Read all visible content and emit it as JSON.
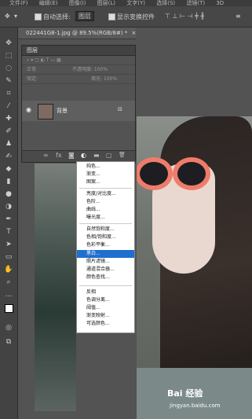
{
  "menubar": {
    "items": [
      "文件(F)",
      "编辑(E)",
      "图像(I)",
      "图层(L)",
      "文字(Y)",
      "选择(S)",
      "滤镜(T)",
      "3D"
    ]
  },
  "options": {
    "auto_select_label": "自动选择:",
    "auto_select_value": "图层",
    "show_transform_label": "显示变换控件"
  },
  "document": {
    "tab_title": "022441G8-1.jpg @ 89.5%(RGB/8#) *",
    "close": "×"
  },
  "layers_panel": {
    "title": "图层",
    "blend_mode": "正常",
    "opacity": "不透明度: 100%",
    "lock_label": "锁定:",
    "fill": "填充: 100%",
    "layer_name": "背景",
    "footer_icons": [
      "link-icon",
      "fx-icon",
      "mask-icon",
      "adjustment-icon",
      "folder-icon",
      "new-layer-icon",
      "trash-icon"
    ],
    "footer_glyphs": [
      "∞",
      "fx",
      "◙",
      "◐",
      "▬",
      "▢",
      "🗑"
    ]
  },
  "adjust_menu": {
    "items": [
      "纯色...",
      "渐变...",
      "图案...",
      "亮度/对比度...",
      "色阶...",
      "曲线...",
      "曝光度...",
      "自然饱和度...",
      "色相/饱和度...",
      "色彩平衡...",
      "黑白...",
      "照片滤镜...",
      "通道混合器...",
      "颜色查找...",
      "反相",
      "色调分离...",
      "阈值...",
      "渐变映射...",
      "可选颜色..."
    ],
    "highlighted": "黑白..."
  },
  "watermark": {
    "brand": "Bai 经验",
    "url": "jingyan.baidu.com"
  }
}
